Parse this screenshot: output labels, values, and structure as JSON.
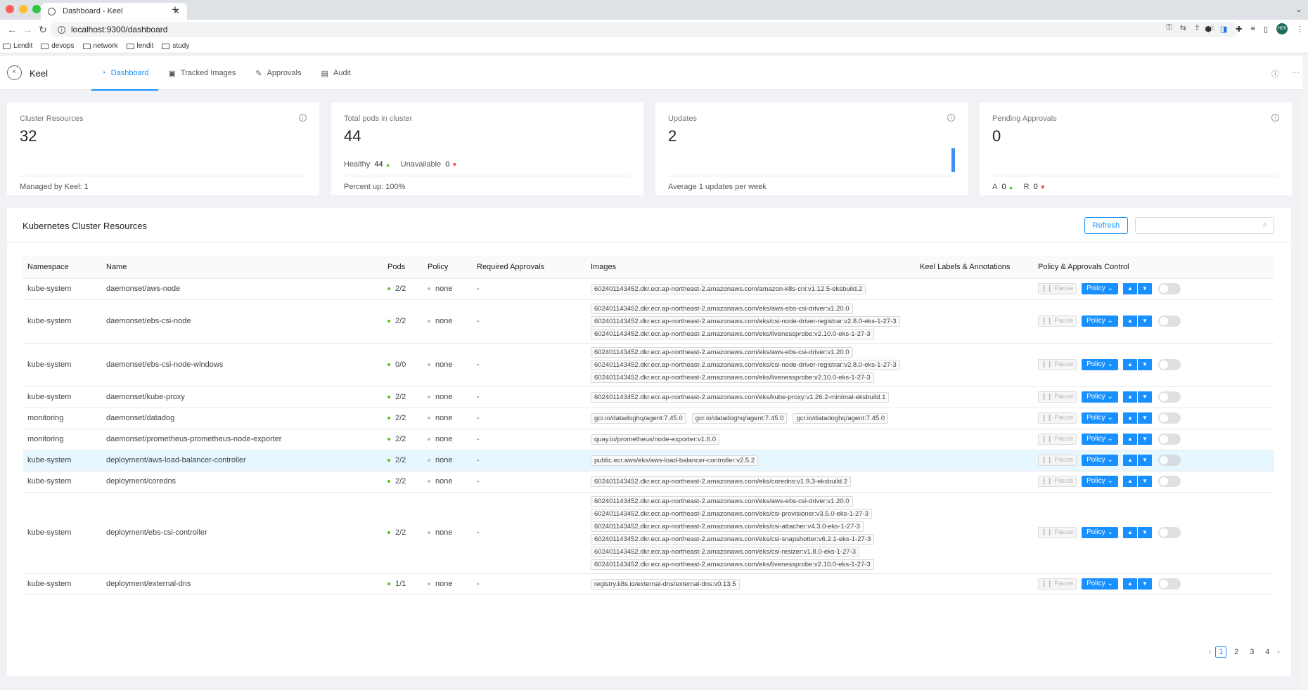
{
  "browser": {
    "tab_title": "Dashboard - Keel",
    "url": "localhost:9300/dashboard",
    "avatar_initials": "HEB",
    "bookmarks": [
      "Lendit",
      "devops",
      "network",
      "lendit",
      "study"
    ]
  },
  "app": {
    "brand": "Keel",
    "logo_text": "K",
    "menu": [
      {
        "label": "Dashboard",
        "icon": "dashboard-icon",
        "active": true
      },
      {
        "label": "Tracked Images",
        "icon": "image-icon",
        "active": false
      },
      {
        "label": "Approvals",
        "icon": "edit-icon",
        "active": false
      },
      {
        "label": "Audit",
        "icon": "audit-icon",
        "active": false
      }
    ],
    "accent_color": "#1890ff"
  },
  "cards": {
    "cluster_resources": {
      "title": "Cluster Resources",
      "value": "32",
      "footer": "Managed by Keel: 1"
    },
    "total_pods": {
      "title": "Total pods in cluster",
      "value": "44",
      "healthy_label": "Healthy",
      "healthy_value": "44",
      "unavailable_label": "Unavailable",
      "unavailable_value": "0",
      "footer": "Percent up: 100%"
    },
    "updates": {
      "title": "Updates",
      "value": "2",
      "footer": "Average 1 updates per week"
    },
    "pending_approvals": {
      "title": "Pending Approvals",
      "value": "0",
      "a_label": "A",
      "a_value": "0",
      "r_label": "R",
      "r_value": "0"
    }
  },
  "panel": {
    "title": "Kubernetes Cluster Resources",
    "refresh_label": "Refresh",
    "search_placeholder": ""
  },
  "table": {
    "columns": [
      "Namespace",
      "Name",
      "Pods",
      "Policy",
      "Required Approvals",
      "Images",
      "Keel Labels & Annotations",
      "Policy & Approvals Control"
    ],
    "controls": {
      "pause": "Pause",
      "policy": "Policy"
    },
    "rows": [
      {
        "namespace": "kube-system",
        "name": "daemonset/aws-node",
        "pods": "2/2",
        "policy": "none",
        "approvals": "-",
        "images": [
          "602401143452.dkr.ecr.ap-northeast-2.amazonaws.com/amazon-k8s-cni:v1.12.5-eksbuild.2"
        ]
      },
      {
        "namespace": "kube-system",
        "name": "daemonset/ebs-csi-node",
        "pods": "2/2",
        "policy": "none",
        "approvals": "-",
        "images": [
          "602401143452.dkr.ecr.ap-northeast-2.amazonaws.com/eks/aws-ebs-csi-driver:v1.20.0",
          "602401143452.dkr.ecr.ap-northeast-2.amazonaws.com/eks/csi-node-driver-registrar:v2.8.0-eks-1-27-3",
          "602401143452.dkr.ecr.ap-northeast-2.amazonaws.com/eks/livenessprobe:v2.10.0-eks-1-27-3"
        ]
      },
      {
        "namespace": "kube-system",
        "name": "daemonset/ebs-csi-node-windows",
        "pods": "0/0",
        "policy": "none",
        "approvals": "-",
        "images": [
          "602401143452.dkr.ecr.ap-northeast-2.amazonaws.com/eks/aws-ebs-csi-driver:v1.20.0",
          "602401143452.dkr.ecr.ap-northeast-2.amazonaws.com/eks/csi-node-driver-registrar:v2.8.0-eks-1-27-3",
          "602401143452.dkr.ecr.ap-northeast-2.amazonaws.com/eks/livenessprobe:v2.10.0-eks-1-27-3"
        ]
      },
      {
        "namespace": "kube-system",
        "name": "daemonset/kube-proxy",
        "pods": "2/2",
        "policy": "none",
        "approvals": "-",
        "images": [
          "602401143452.dkr.ecr.ap-northeast-2.amazonaws.com/eks/kube-proxy:v1.26.2-minimal-eksbuild.1"
        ]
      },
      {
        "namespace": "monitoring",
        "name": "daemonset/datadog",
        "pods": "2/2",
        "policy": "none",
        "approvals": "-",
        "inline": true,
        "images": [
          "gcr.io/datadoghq/agent:7.45.0",
          "gcr.io/datadoghq/agent:7.45.0",
          "gcr.io/datadoghq/agent:7.45.0"
        ]
      },
      {
        "namespace": "monitoring",
        "name": "daemonset/prometheus-prometheus-node-exporter",
        "pods": "2/2",
        "policy": "none",
        "approvals": "-",
        "images": [
          "quay.io/prometheus/node-exporter:v1.6.0"
        ]
      },
      {
        "namespace": "kube-system",
        "name": "deployment/aws-load-balancer-controller",
        "pods": "2/2",
        "policy": "none",
        "approvals": "-",
        "highlight": true,
        "images": [
          "public.ecr.aws/eks/aws-load-balancer-controller:v2.5.2"
        ]
      },
      {
        "namespace": "kube-system",
        "name": "deployment/coredns",
        "pods": "2/2",
        "policy": "none",
        "approvals": "-",
        "images": [
          "602401143452.dkr.ecr.ap-northeast-2.amazonaws.com/eks/coredns:v1.9.3-eksbuild.2"
        ]
      },
      {
        "namespace": "kube-system",
        "name": "deployment/ebs-csi-controller",
        "pods": "2/2",
        "policy": "none",
        "approvals": "-",
        "images": [
          "602401143452.dkr.ecr.ap-northeast-2.amazonaws.com/eks/aws-ebs-csi-driver:v1.20.0",
          "602401143452.dkr.ecr.ap-northeast-2.amazonaws.com/eks/csi-provisioner:v3.5.0-eks-1-27-3",
          "602401143452.dkr.ecr.ap-northeast-2.amazonaws.com/eks/csi-attacher:v4.3.0-eks-1-27-3",
          "602401143452.dkr.ecr.ap-northeast-2.amazonaws.com/eks/csi-snapshotter:v6.2.1-eks-1-27-3",
          "602401143452.dkr.ecr.ap-northeast-2.amazonaws.com/eks/csi-resizer:v1.8.0-eks-1-27-3",
          "602401143452.dkr.ecr.ap-northeast-2.amazonaws.com/eks/livenessprobe:v2.10.0-eks-1-27-3"
        ]
      },
      {
        "namespace": "kube-system",
        "name": "deployment/external-dns",
        "pods": "1/1",
        "policy": "none",
        "approvals": "-",
        "images": [
          "registry.k8s.io/external-dns/external-dns:v0.13.5"
        ]
      }
    ]
  },
  "pagination": {
    "pages": [
      "1",
      "2",
      "3",
      "4"
    ],
    "current": "1"
  }
}
